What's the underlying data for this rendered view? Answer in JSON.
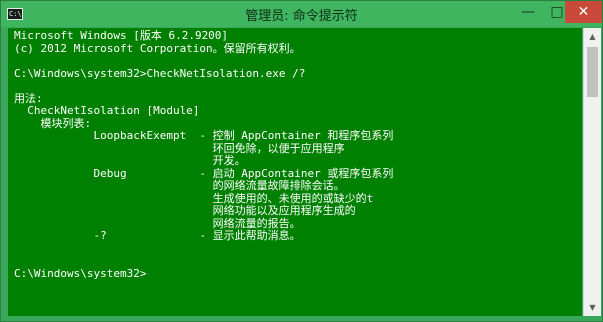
{
  "window": {
    "title": "管理员: 命令提示符",
    "icon_label": "C:\\",
    "buttons": {
      "minimize": "—",
      "maximize": "□",
      "close": "✕"
    }
  },
  "console": {
    "lines": [
      "Microsoft Windows [版本 6.2.9200]",
      "(c) 2012 Microsoft Corporation。保留所有权利。",
      "",
      "C:\\Windows\\system32>CheckNetIsolation.exe /?",
      "",
      "用法:",
      "  CheckNetIsolation [Module]",
      "    模块列表:",
      "            LoopbackExempt  - 控制 AppContainer 和程序包系列",
      "                              环回免除，以便于应用程序",
      "                              开发。",
      "            Debug           - 启动 AppContainer 或程序包系列",
      "                              的网络流量故障排除会话。",
      "                              生成使用的、未使用的或缺少的t",
      "                              网络功能以及应用程序生成的",
      "                              网络流量的报告。",
      "            -?              - 显示此帮助消息。",
      "",
      "",
      "C:\\Windows\\system32>"
    ]
  },
  "colors": {
    "console_background": "#008000",
    "titlebar": "#3fb560",
    "text": "#ffffff",
    "close_button": "#c9493a"
  },
  "scrollbar": {
    "up_icon": "arrow-up",
    "down_icon": "arrow-down"
  }
}
